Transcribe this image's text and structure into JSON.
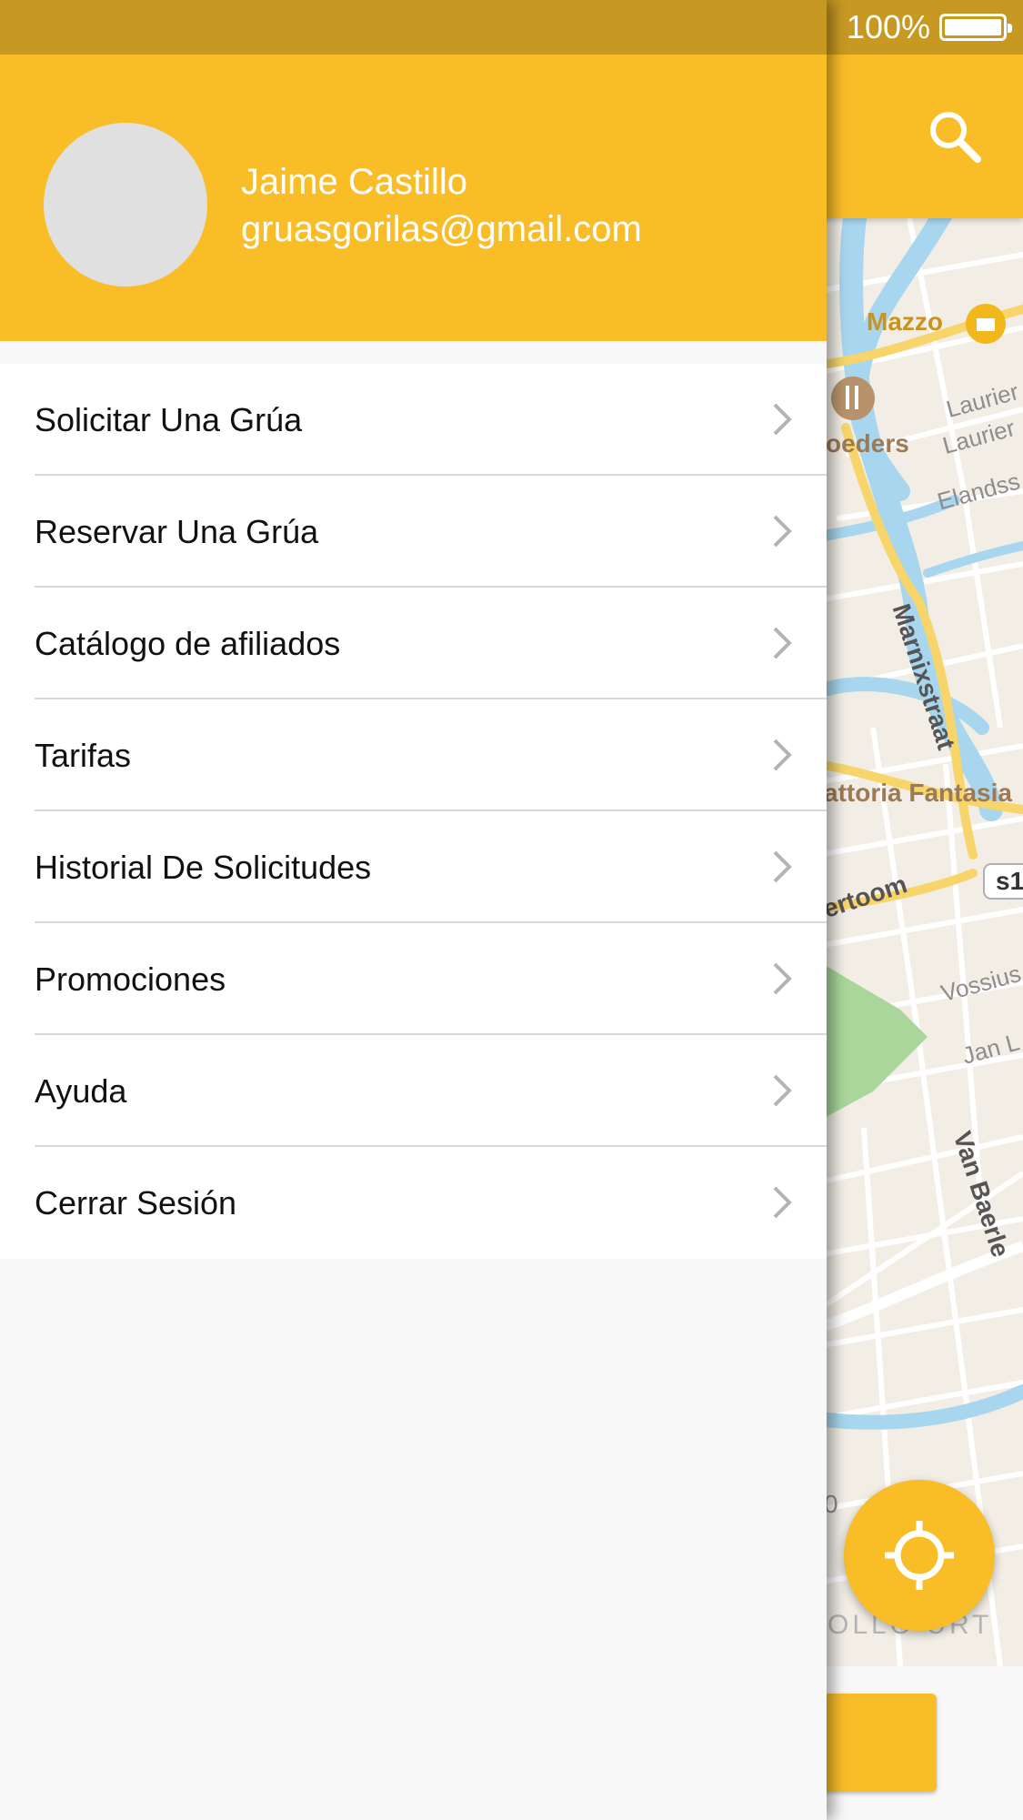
{
  "status_bar": {
    "battery_percent": "100%"
  },
  "drawer": {
    "user": {
      "name": "Jaime Castillo",
      "email": "gruasgorilas@gmail.com"
    },
    "menu_items": [
      {
        "label": "Solicitar Una Grúa"
      },
      {
        "label": "Reservar Una Grúa"
      },
      {
        "label": "Catálogo de afiliados"
      },
      {
        "label": "Tarifas"
      },
      {
        "label": "Historial De Solicitudes"
      },
      {
        "label": "Promociones"
      },
      {
        "label": "Ayuda"
      },
      {
        "label": "Cerrar Sesión"
      }
    ]
  },
  "map": {
    "labels": {
      "mazzo": "Mazzo",
      "lauriergracht_1": "Laurier",
      "lauriergracht_2": "Laurier",
      "eland": "Elandss",
      "beeders": "oeders",
      "marnixstraat": "Marnixstraat",
      "trattoria": "attoria Fantasia",
      "overtoom": "ertoom",
      "road_badge": "s1",
      "vossius": "Vossius",
      "janluijken": "Jan L",
      "vanbaerle": "Van Baerle",
      "hollandsche": "OLLO  URT",
      "edge_letter": "0"
    }
  },
  "colors": {
    "primary": "#f9bd28",
    "status_bar": "#c89922",
    "drawer_bg": "#f8f8f8",
    "map_water": "#a7d6ee",
    "map_road_major": "#f7d56b",
    "map_park": "#a9d69a"
  },
  "icons": {
    "search": "search-icon",
    "locate": "crosshair-icon",
    "chevron": "chevron-right-icon",
    "battery": "battery-icon"
  }
}
